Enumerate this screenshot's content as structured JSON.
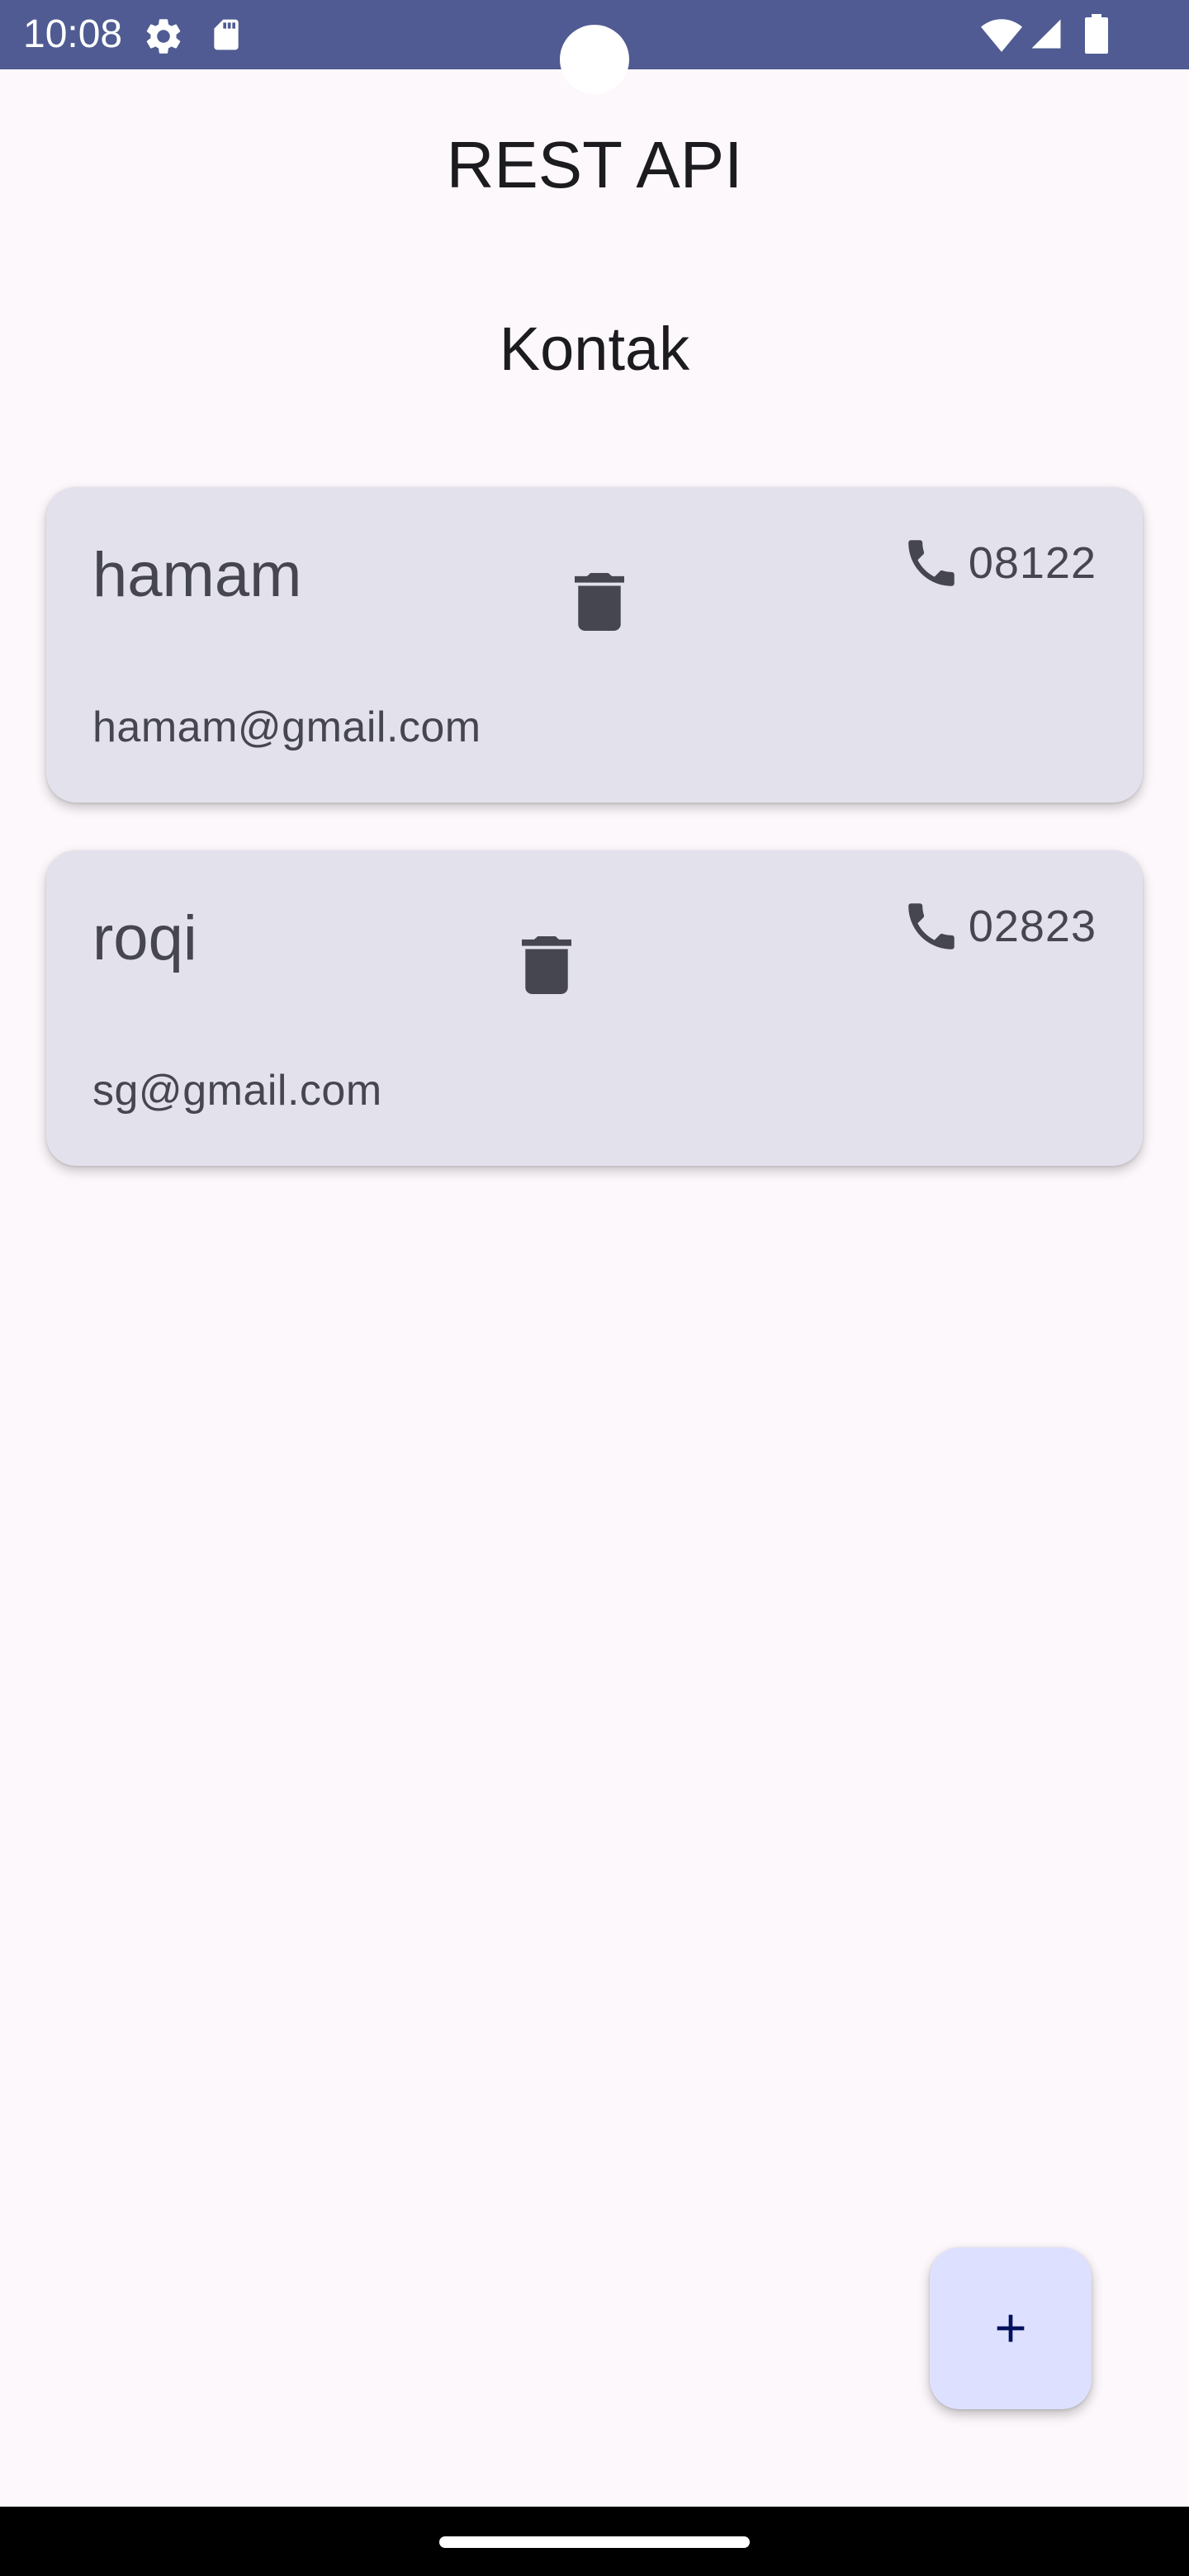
{
  "status_bar": {
    "time": "10:08",
    "icons": [
      "settings-gear-icon",
      "sd-card-icon",
      "wifi-icon",
      "cellular-signal-icon",
      "battery-icon"
    ],
    "background": "#4f5b92"
  },
  "app_bar": {
    "title": "REST API"
  },
  "section": {
    "title": "Kontak"
  },
  "contacts": [
    {
      "name": "hamam",
      "email": "hamam@gmail.com",
      "phone": "08122"
    },
    {
      "name": "roqi",
      "email": "sg@gmail.com",
      "phone": "02823"
    }
  ],
  "icons": {
    "delete": "trash-icon",
    "phone": "phone-icon",
    "fab": "plus-icon"
  },
  "colors": {
    "background": "#fdf8fc",
    "card": "#e3e1ec",
    "card_text": "#45464f",
    "fab": "#dde1ff",
    "fab_icon": "#00105c"
  }
}
